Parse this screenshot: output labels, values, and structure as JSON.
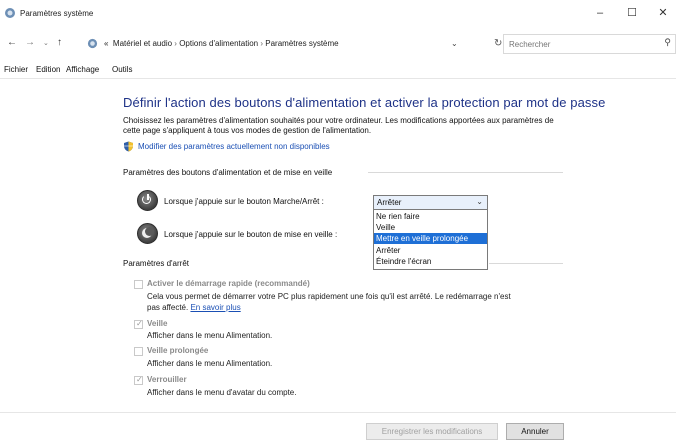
{
  "window": {
    "title": "Paramètres système"
  },
  "address": {
    "chevrons": "«",
    "crumbs": [
      "Matériel et audio",
      "Options d'alimentation",
      "Paramètres système"
    ],
    "separator": "›"
  },
  "search": {
    "placeholder": "Rechercher"
  },
  "menu": [
    "Fichier",
    "Edition",
    "Affichage",
    "Outils"
  ],
  "main": {
    "heading": "Définir l'action des boutons d'alimentation et activer la protection par mot de passe",
    "description": "Choisissez les paramètres d'alimentation souhaités pour votre ordinateur. Les modifications apportées aux paramètres de cette page s'appliquent à tous vos modes de gestion de l'alimentation.",
    "modify_link": "Modifier des paramètres actuellement non disponibles"
  },
  "buttons_section": {
    "label": "Paramètres des boutons d'alimentation et de mise en veille",
    "power_row": "Lorsque j'appuie sur le bouton Marche/Arrêt :",
    "sleep_row": "Lorsque j'appuie sur le bouton de mise en veille :",
    "combo_value": "Arrêter",
    "options": [
      "Ne rien faire",
      "Veille",
      "Mettre en veille prolongée",
      "Arrêter",
      "Éteindre l'écran"
    ],
    "highlighted_index": 2
  },
  "shutdown_section": {
    "label": "Paramètres d'arrêt",
    "items": [
      {
        "title": "Activer le démarrage rapide (recommandé)",
        "checked": false,
        "desc1": "Cela vous permet de démarrer votre PC plus rapidement une fois qu'il est arrêté. Le redémarrage n'est",
        "desc2": "pas affecté.",
        "link": "En savoir plus"
      },
      {
        "title": "Veille",
        "checked": true,
        "desc1": "Afficher dans le menu Alimentation."
      },
      {
        "title": "Veille prolongée",
        "checked": false,
        "desc1": "Afficher dans le menu Alimentation."
      },
      {
        "title": "Verrouiller",
        "checked": true,
        "desc1": "Afficher dans le menu d'avatar du compte."
      }
    ]
  },
  "footer": {
    "save_label": "Enregistrer les modifications",
    "cancel_label": "Annuler"
  },
  "colors": {
    "heading": "#1e3287",
    "link": "#1a4fb4",
    "selection": "#1e6fd6"
  },
  "icons": {
    "app": "power-options-icon",
    "shield": "uac-shield-icon"
  }
}
